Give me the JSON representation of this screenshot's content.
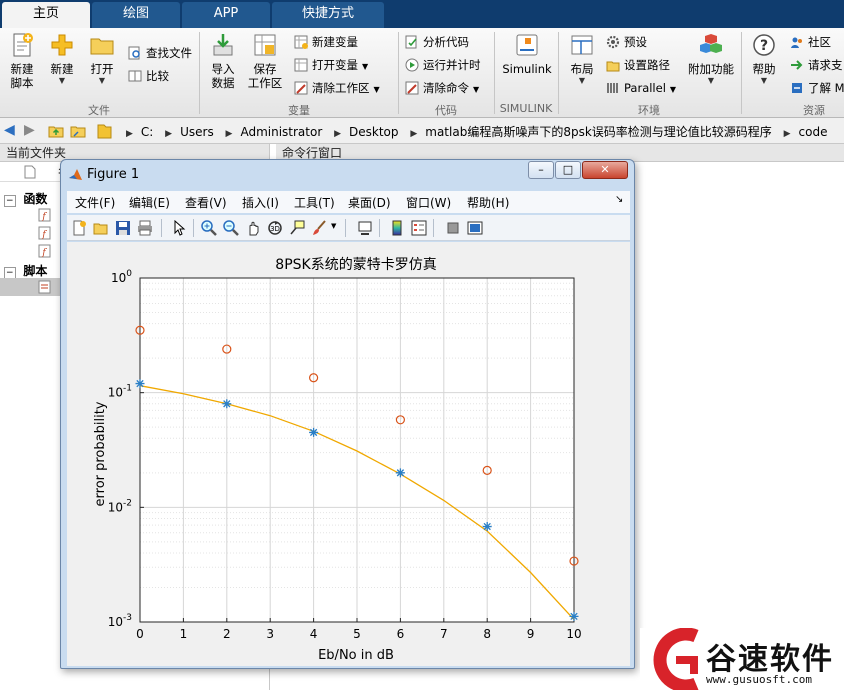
{
  "tabs": [
    {
      "label": "主页",
      "active": true
    },
    {
      "label": "绘图",
      "active": false
    },
    {
      "label": "APP",
      "active": false
    },
    {
      "label": "快捷方式",
      "active": false
    }
  ],
  "ribbon": {
    "file": {
      "group_label": "文件",
      "new_script": "新建\n脚本",
      "new": "新建",
      "open": "打开",
      "find_files": "查找文件",
      "compare": "比较"
    },
    "variable": {
      "group_label": "变量",
      "import_data": "导入\n数据",
      "save_workspace": "保存\n工作区",
      "new_variable": "新建变量",
      "open_variable": "打开变量",
      "clear_workspace": "清除工作区"
    },
    "code": {
      "group_label": "代码",
      "analyze_code": "分析代码",
      "run_and_time": "运行并计时",
      "clear_commands": "清除命令"
    },
    "simulink": {
      "group_label": "SIMULINK",
      "simulink": "Simulink"
    },
    "environment": {
      "group_label": "环境",
      "layout": "布局",
      "preferences": "预设",
      "set_path": "设置路径",
      "parallel": "Parallel",
      "addons": "附加功能"
    },
    "resources": {
      "group_label": "资源",
      "help": "帮助",
      "community": "社区",
      "request_support": "请求支",
      "learn": "了解 M"
    }
  },
  "address": {
    "crumbs": [
      "C:",
      "Users",
      "Administrator",
      "Desktop",
      "matlab编程高斯噪声下的8psk误码率检测与理论值比较源码程序",
      "code"
    ]
  },
  "current_folder": {
    "header": "当前文件夹",
    "name_column": "名",
    "functions_label": "函数",
    "scripts_label": "脚本"
  },
  "command_window": {
    "header": "命令行窗口"
  },
  "figure": {
    "title": "Figure 1",
    "menus": [
      "文件(F)",
      "编辑(E)",
      "查看(V)",
      "插入(I)",
      "工具(T)",
      "桌面(D)",
      "窗口(W)",
      "帮助(H)"
    ],
    "toolbar_icons": [
      "new-figure-icon",
      "open-icon",
      "save-icon",
      "print-icon",
      "pointer-icon",
      "zoom-in-icon",
      "zoom-out-icon",
      "pan-icon",
      "rotate-icon",
      "data-cursor-icon",
      "brush-icon",
      "link-icon",
      "colorbar-icon",
      "legend-icon",
      "hide-plot-tools-icon",
      "show-plot-tools-icon"
    ]
  },
  "chart_data": {
    "type": "line",
    "title": "8PSK系统的蒙特卡罗仿真",
    "xlabel": "Eb/No in dB",
    "ylabel": "error probability",
    "xlim": [
      0,
      10
    ],
    "ylim": [
      0.001,
      1
    ],
    "yscale": "log",
    "grid": true,
    "x_ticks": [
      "0",
      "1",
      "2",
      "3",
      "4",
      "5",
      "6",
      "7",
      "8",
      "9",
      "10"
    ],
    "y_ticks": [
      "10^0",
      "10^-1",
      "10^-2",
      "10^-3"
    ],
    "series": [
      {
        "style": "circle-markers",
        "color": "#d95319",
        "x": [
          0,
          2,
          4,
          6,
          8,
          10
        ],
        "y": [
          0.35,
          0.24,
          0.135,
          0.058,
          0.021,
          0.0034
        ]
      },
      {
        "style": "star-markers",
        "color": "#2a7fc6",
        "x": [
          0,
          2,
          4,
          6,
          8,
          10
        ],
        "y": [
          0.12,
          0.08,
          0.045,
          0.02,
          0.0068,
          0.00112
        ]
      },
      {
        "style": "line",
        "color": "#f0a800",
        "x": [
          0,
          1,
          2,
          3,
          4,
          5,
          6,
          7,
          8,
          9,
          10
        ],
        "y": [
          0.115,
          0.098,
          0.08,
          0.063,
          0.046,
          0.031,
          0.0195,
          0.0115,
          0.0062,
          0.0027,
          0.00105
        ]
      }
    ]
  },
  "watermark": {
    "brand": "谷速软件",
    "url": "www.gusuosft.com"
  }
}
